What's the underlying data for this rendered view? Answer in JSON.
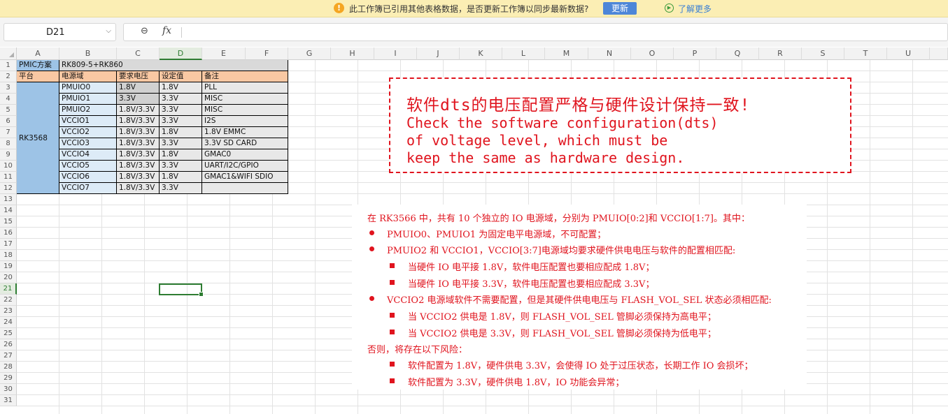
{
  "notification": {
    "message": "此工作簿已引用其他表格数据，是否更新工作簿以同步最新数据?",
    "update_button": "更新",
    "learn_more": "了解更多"
  },
  "formula_bar": {
    "name_box": "D21",
    "fx_label": "fx",
    "formula": ""
  },
  "columns": [
    "A",
    "B",
    "C",
    "D",
    "E",
    "F",
    "G",
    "H",
    "I",
    "J",
    "K",
    "L",
    "M",
    "N",
    "O",
    "P",
    "Q",
    "R",
    "S",
    "T",
    "U"
  ],
  "selected_column": "D",
  "rows": [
    "1",
    "2",
    "3",
    "4",
    "5",
    "6",
    "7",
    "8",
    "9",
    "10",
    "11",
    "12",
    "13",
    "14",
    "15",
    "16",
    "17",
    "18",
    "19",
    "20",
    "21",
    "22",
    "23",
    "24",
    "25",
    "26",
    "27",
    "28",
    "29",
    "30",
    "31"
  ],
  "selected_row": "21",
  "table": {
    "r1": {
      "a": "PMIC方案",
      "b": "RK809-5+RK860"
    },
    "headers": {
      "a": "平台",
      "b": "电源域",
      "c": "要求电压",
      "d": "设定值",
      "e": "备注"
    },
    "platform": "RK3568",
    "rows": [
      {
        "b": "PMUIO0",
        "c": "1.8V",
        "d": "1.8V",
        "e": "PLL"
      },
      {
        "b": "PMUIO1",
        "c": "3.3V",
        "d": "3.3V",
        "e": "MISC"
      },
      {
        "b": "PMUIO2",
        "c": "1.8V/3.3V",
        "d": "3.3V",
        "e": "MISC"
      },
      {
        "b": "VCCIO1",
        "c": "1.8V/3.3V",
        "d": "3.3V",
        "e": "I2S"
      },
      {
        "b": "VCCIO2",
        "c": "1.8V/3.3V",
        "d": "1.8V",
        "e": "1.8V EMMC"
      },
      {
        "b": "VCCIO3",
        "c": "1.8V/3.3V",
        "d": "3.3V",
        "e": "3.3V SD CARD"
      },
      {
        "b": "VCCIO4",
        "c": "1.8V/3.3V",
        "d": "1.8V",
        "e": "GMAC0"
      },
      {
        "b": "VCCIO5",
        "c": "1.8V/3.3V",
        "d": "3.3V",
        "e": "UART/I2C/GPIO"
      },
      {
        "b": "VCCIO6",
        "c": "1.8V/3.3V",
        "d": "1.8V",
        "e": "GMAC1&WIFI SDIO"
      },
      {
        "b": "VCCIO7",
        "c": "1.8V/3.3V",
        "d": "3.3V",
        "e": ""
      }
    ]
  },
  "note_box": {
    "zh": "软件dts的电压配置严格与硬件设计保持一致!",
    "en1": "Check the software configuration(dts)",
    "en2": "of voltage level, which must be",
    "en3": "keep the same as hardware design."
  },
  "doc": {
    "l1": "在 RK3566 中，共有 10 个独立的 IO 电源域，分别为 PMUIO[0:2]和 VCCIO[1:7]。其中：",
    "l2": "PMUIO0、PMUIO1 为固定电平电源域，不可配置；",
    "l3": "PMUIO2 和 VCCIO1，VCCIO[3:7]电源域均要求硬件供电电压与软件的配置相匹配:",
    "l4": "当硬件 IO 电平接 1.8V，软件电压配置也要相应配成 1.8V；",
    "l5": "当硬件 IO 电平接 3.3V，软件电压配置也要相应配成 3.3V；",
    "l6": "VCCIO2 电源域软件不需要配置，但是其硬件供电电压与 FLASH_VOL_SEL 状态必须相匹配:",
    "l7": "当 VCCIO2 供电是 1.8V，则 FLASH_VOL_SEL 管脚必须保持为高电平；",
    "l8": "当 VCCIO2 供电是 3.3V，则 FLASH_VOL_SEL 管脚必须保持为低电平；",
    "l9": "否则，将存在以下风险：",
    "l10": "软件配置为 1.8V，硬件供电 3.3V，会使得 IO 处于过压状态，长期工作 IO 会损坏；",
    "l11": "软件配置为 3.3V，硬件供电 1.8V，IO 功能会异常；"
  },
  "colors": {
    "header_fill": "#f9c8a3",
    "platform_fill": "#9dc3e6",
    "domain_fill": "#ddebf7",
    "voltage_fill": "#d0d0d0",
    "note_red": "#e0141e",
    "selection_green": "#2e7d32"
  }
}
